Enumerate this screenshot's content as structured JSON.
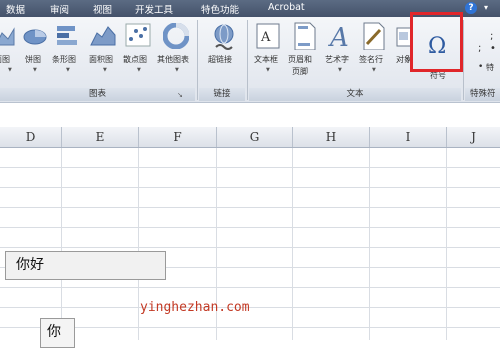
{
  "menu": {
    "tabs": [
      {
        "label": "数据"
      },
      {
        "label": "审阅"
      },
      {
        "label": "视图"
      },
      {
        "label": "开发工具"
      },
      {
        "label": "特色功能"
      },
      {
        "label": "Acrobat"
      }
    ]
  },
  "ribbon": {
    "charts": {
      "label": "图表",
      "items": [
        {
          "label": "面图"
        },
        {
          "label": "饼图"
        },
        {
          "label": "条形图"
        },
        {
          "label": "面积图"
        },
        {
          "label": "散点图"
        },
        {
          "label": "其他图表"
        }
      ]
    },
    "links": {
      "label": "链接",
      "hyperlink": "超链接"
    },
    "text": {
      "label": "文本",
      "textbox": "文本框",
      "header_footer_line1": "页眉和",
      "header_footer_line2": "页脚",
      "wordart": "艺术字",
      "signature": "签名行",
      "object": "对象",
      "symbol": "符号",
      "symbol_glyph": "Ω"
    },
    "special": {
      "label": "特殊符",
      "bullet_item": "特"
    }
  },
  "columns": [
    "D",
    "E",
    "F",
    "G",
    "H",
    "I",
    "J"
  ],
  "cells": {
    "textbox1": "你好",
    "textbox2": "你"
  },
  "watermark": "yinghezhan.com",
  "colors": {
    "highlight": "#e0262a",
    "tab_bar": "#4d5b73",
    "watermark": "#c33a25"
  }
}
